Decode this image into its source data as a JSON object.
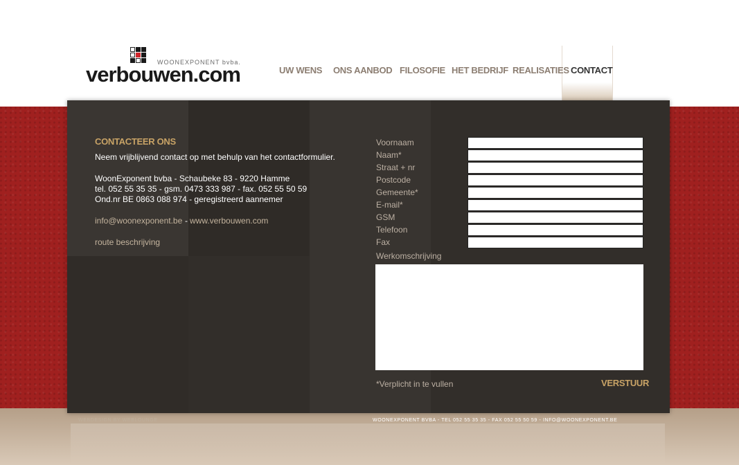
{
  "colors": {
    "red_background": "#a0201f",
    "panel": "#322e2a",
    "accent_gold": "#c8a366",
    "nav_text": "#8c7e72",
    "nav_active_text": "#333333",
    "link_text": "#c4b49e",
    "label_text": "#bcb0a3"
  },
  "logo": {
    "company": "WOONEXPONENT bvba.",
    "text": "verbouwen.com",
    "icon": "squares-logo-icon"
  },
  "nav": {
    "items": [
      {
        "label": "UW WENS"
      },
      {
        "label": "ONS AANBOD"
      },
      {
        "label": "FILOSOFIE"
      },
      {
        "label": "HET BEDRIJF"
      },
      {
        "label": "REALISATIES"
      },
      {
        "label": "CONTACT"
      }
    ],
    "active": "CONTACT"
  },
  "contact": {
    "heading": "CONTACTEER ONS",
    "intro": "Neem vrijblijvend contact op met behulp van het contactformulier.",
    "address": "WoonExponent bvba - Schaubeke 83 - 9220 Hamme",
    "phones": "tel. 052 55 35 35 - gsm. 0473 333 987 - fax. 052 55 50 59",
    "registration": "Ond.nr BE 0863 088 974 - geregistreerd aannemer",
    "email": "info@woonexponent.be",
    "separator": "-",
    "website": "www.verbouwen.com",
    "route": "route beschrijving"
  },
  "form": {
    "fields": [
      {
        "label": "Voornaam",
        "value": ""
      },
      {
        "label": "Naam*",
        "value": ""
      },
      {
        "label": "Straat + nr",
        "value": ""
      },
      {
        "label": "Postcode",
        "value": ""
      },
      {
        "label": "Gemeente*",
        "value": ""
      },
      {
        "label": "E-mail*",
        "value": ""
      },
      {
        "label": "GSM",
        "value": ""
      },
      {
        "label": "Telefoon",
        "value": ""
      },
      {
        "label": "Fax",
        "value": ""
      }
    ],
    "textarea_label": "Werkomschrijving",
    "textarea_value": "",
    "required_note": "*Verplicht in te vullen",
    "submit_label": "VERSTUUR"
  },
  "footer": {
    "credit": "WEBDESIGN BY WEBLOUNGE",
    "info": "WOONEXPONENT BVBA - TEL 052 55 35 35 - FAX 052 55 50 59 - INFO@WOONEXPONENT.BE"
  }
}
